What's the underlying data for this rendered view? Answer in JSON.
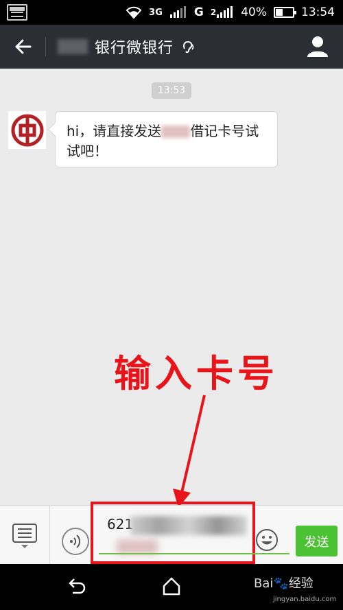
{
  "status_bar": {
    "network_3g": "3G",
    "network_g": "G",
    "network_2": "2",
    "battery_percent": "40%",
    "battery_level": 0.4,
    "time": "13:54"
  },
  "title_bar": {
    "title": "银行微银行"
  },
  "chat": {
    "time_badge": "13:53",
    "messages": [
      {
        "text_part1": "hi，请直接发送",
        "text_part2": "借记卡号试试吧！"
      }
    ]
  },
  "annotation": {
    "label": "输入卡号"
  },
  "input": {
    "visible_value": "621",
    "send_label": "发送"
  },
  "watermark": {
    "brand": "Bai",
    "brand_cn": "经验",
    "url": "jingyan.baidu.com"
  },
  "colors": {
    "accent_red": "#e8141a",
    "send_green": "#4bc134",
    "titlebar_bg": "#2b2e33",
    "bank_logo_red": "#b32024"
  }
}
